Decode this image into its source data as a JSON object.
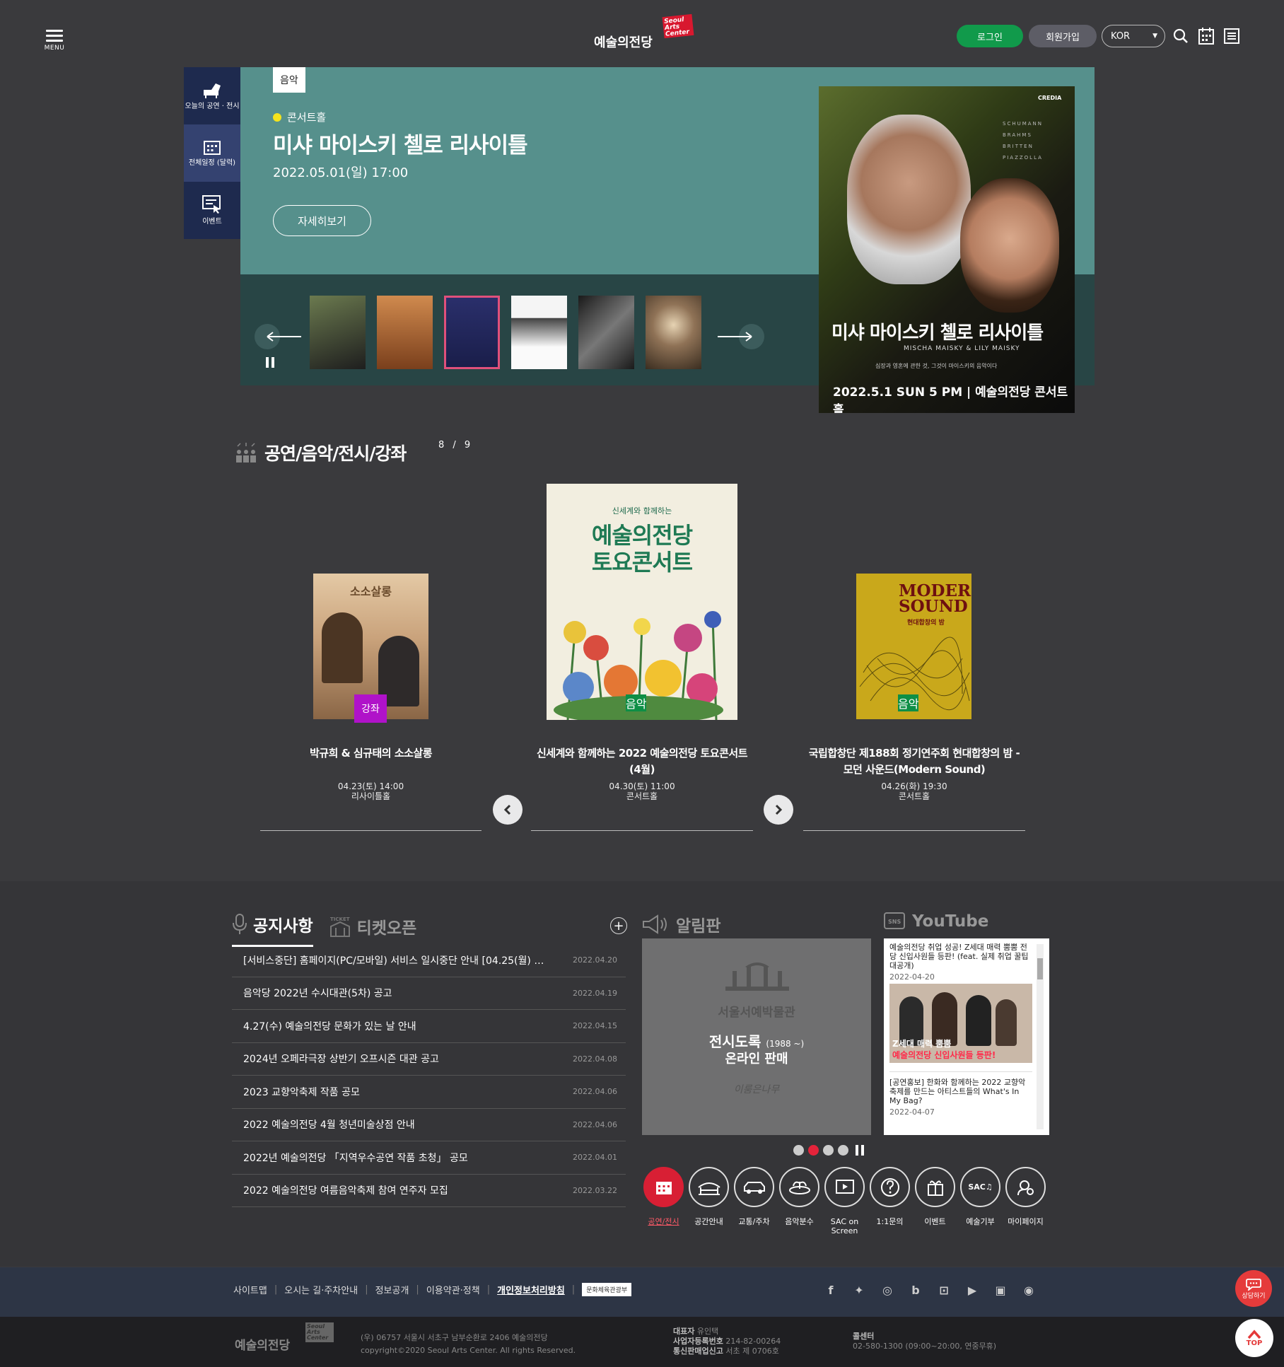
{
  "header": {
    "menu_label": "MENU",
    "logo_text": "예술의전당",
    "logo_badge": "Seoul Arts Center",
    "login": "로그인",
    "join": "회원가입",
    "language": "KOR"
  },
  "quick_side": [
    {
      "label": "오늘의 공연 · 전시",
      "icon": "piano-icon"
    },
    {
      "label": "전체일정 (달력)",
      "icon": "calendar-icon"
    },
    {
      "label": "이벤트",
      "icon": "event-icon"
    }
  ],
  "hero": {
    "tag": "음악",
    "venue": "콘서트홀",
    "title": "미샤 마이스키 첼로 리사이틀",
    "date": "2022.05.01(일) 17:00",
    "detail_button": "자세히보기",
    "poster": {
      "brand": "CREDIA",
      "composers": [
        "SCHUMANN",
        "BRAHMS",
        "BRITTEN",
        "PIAZZOLLA"
      ],
      "title": "미샤 마이스키 첼로 리사이틀",
      "subtitle": "MISCHA MAISKY & LILY MAISKY",
      "line": "심장과 영혼에 관한 것, 그것이 마이스키의 음악이다",
      "date": "2022.5.1 SUN 5 PM | 예술의전당 콘서트홀"
    },
    "thumbnail_colors": [
      "#3b3b3b",
      "#b36b3a",
      "#2a2f6b",
      "#f2f2f2",
      "#2c2c2c",
      "#8f7256"
    ]
  },
  "performances": {
    "title": "공연/음악/전시/강좌",
    "pager": "8 / 9",
    "cards": [
      {
        "title": "박규희 & 심규태의 소소살롱",
        "category": "강좌",
        "cat_color": "#b012c9",
        "date": "04.23(토) 14:00",
        "venue": "리사이틀홀"
      },
      {
        "title": "신세계와 함께하는 2022 예술의전당 토요콘서트 (4월)",
        "category": "음악",
        "cat_color": "#0e8f46",
        "date": "04.30(토) 11:00",
        "venue": "콘서트홀",
        "poster_lines": [
          "신세계와 함께하는",
          "예술의전당",
          "토요콘서트"
        ]
      },
      {
        "title": "국립합창단 제188회 정기연주회 현대합창의 밤 - 모던 사운드(Modern Sound)",
        "category": "음악",
        "cat_color": "#0e8f46",
        "date": "04.26(화) 19:30",
        "venue": "콘서트홀",
        "poster_lines": [
          "MODERN",
          "SOUND",
          "현대합창의 밤"
        ]
      }
    ],
    "small_poster_title": "소소살롱"
  },
  "notice": {
    "tabs": [
      "공지사항",
      "티켓오픈"
    ],
    "items": [
      {
        "title": "[서비스중단] 홈페이지(PC/모바일) 서비스 일시중단 안내 [04.25(월) 21:0...",
        "date": "2022.04.20"
      },
      {
        "title": "음악당 2022년 수시대관(5차) 공고",
        "date": "2022.04.19"
      },
      {
        "title": "4.27(수) 예술의전당 문화가 있는 날 안내",
        "date": "2022.04.15"
      },
      {
        "title": "2024년 오페라극장 상반기 오프시즌 대관 공고",
        "date": "2022.04.08"
      },
      {
        "title": "2023 교향악축제 작품 공모",
        "date": "2022.04.06"
      },
      {
        "title": "2022 예술의전당 4월 청년미술상점 안내",
        "date": "2022.04.06"
      },
      {
        "title": "2022년 예술의전당 「지역우수공연 작품 초청」 공모",
        "date": "2022.04.01"
      },
      {
        "title": "2022 예술의전당 여름음악축제 참여 연주자 모집",
        "date": "2022.03.22"
      }
    ]
  },
  "board": {
    "title": "알림판",
    "museum": "서울서예박물관",
    "line1": "전시도록",
    "line1_small": "(1988 ~)",
    "line2": "온라인 판매",
    "sign": "이룸은나무"
  },
  "youtube": {
    "title": "YouTube",
    "items": [
      {
        "title": "예술의전당 취업 성공! Z세대 매력 뿜뿜 전당 신입사원들 등판! (feat. 실제 취업 꿀팁 대공개)",
        "date": "2022-04-20",
        "thumb_caption1": "Z세대 매력 뿜뿜",
        "thumb_caption2": "예술의전당 신입사원들 등판!"
      },
      {
        "title": "[공연홍보] 한화와 함께하는 2022 교향악축제를 만드는 아티스트들의 What's In My Bag?",
        "date": "2022-04-07"
      }
    ]
  },
  "quick_menu": [
    {
      "label": "공연/전시",
      "icon": "calendar-icon",
      "active": true
    },
    {
      "label": "공간안내",
      "icon": "building-icon"
    },
    {
      "label": "교통/주차",
      "icon": "car-icon"
    },
    {
      "label": "음악분수",
      "icon": "fountain-icon"
    },
    {
      "label": "SAC on Screen",
      "icon": "screen-icon"
    },
    {
      "label": "1:1문의",
      "icon": "question-icon"
    },
    {
      "label": "이벤트",
      "icon": "gift-icon"
    },
    {
      "label": "예술기부",
      "icon": "sac-donate-icon"
    },
    {
      "label": "마이페이지",
      "icon": "user-gear-icon"
    }
  ],
  "footer": {
    "links": [
      "사이트맵",
      "오시는 길·주차안내",
      "정보공개",
      "이용약관·정책",
      "개인정보처리방침"
    ],
    "gov": "문화체육관광부",
    "address": "(우) 06757 서울시 서초구 남부순환로 2406 예술의전당",
    "copyright": "copyright©2020 Seoul Arts Center. All rights Reserved.",
    "ceo_label": "대표자",
    "ceo": "유인택",
    "biz_label": "사업자등록번호",
    "biz": "214-82-00264",
    "sales_label": "통신판매업신고",
    "sales": "서초 제 0706호",
    "call_label": "콜센터",
    "call": "02-580-1300 (09:00~20:00, 연중무휴)",
    "chat": "상담하기",
    "top": "TOP"
  }
}
